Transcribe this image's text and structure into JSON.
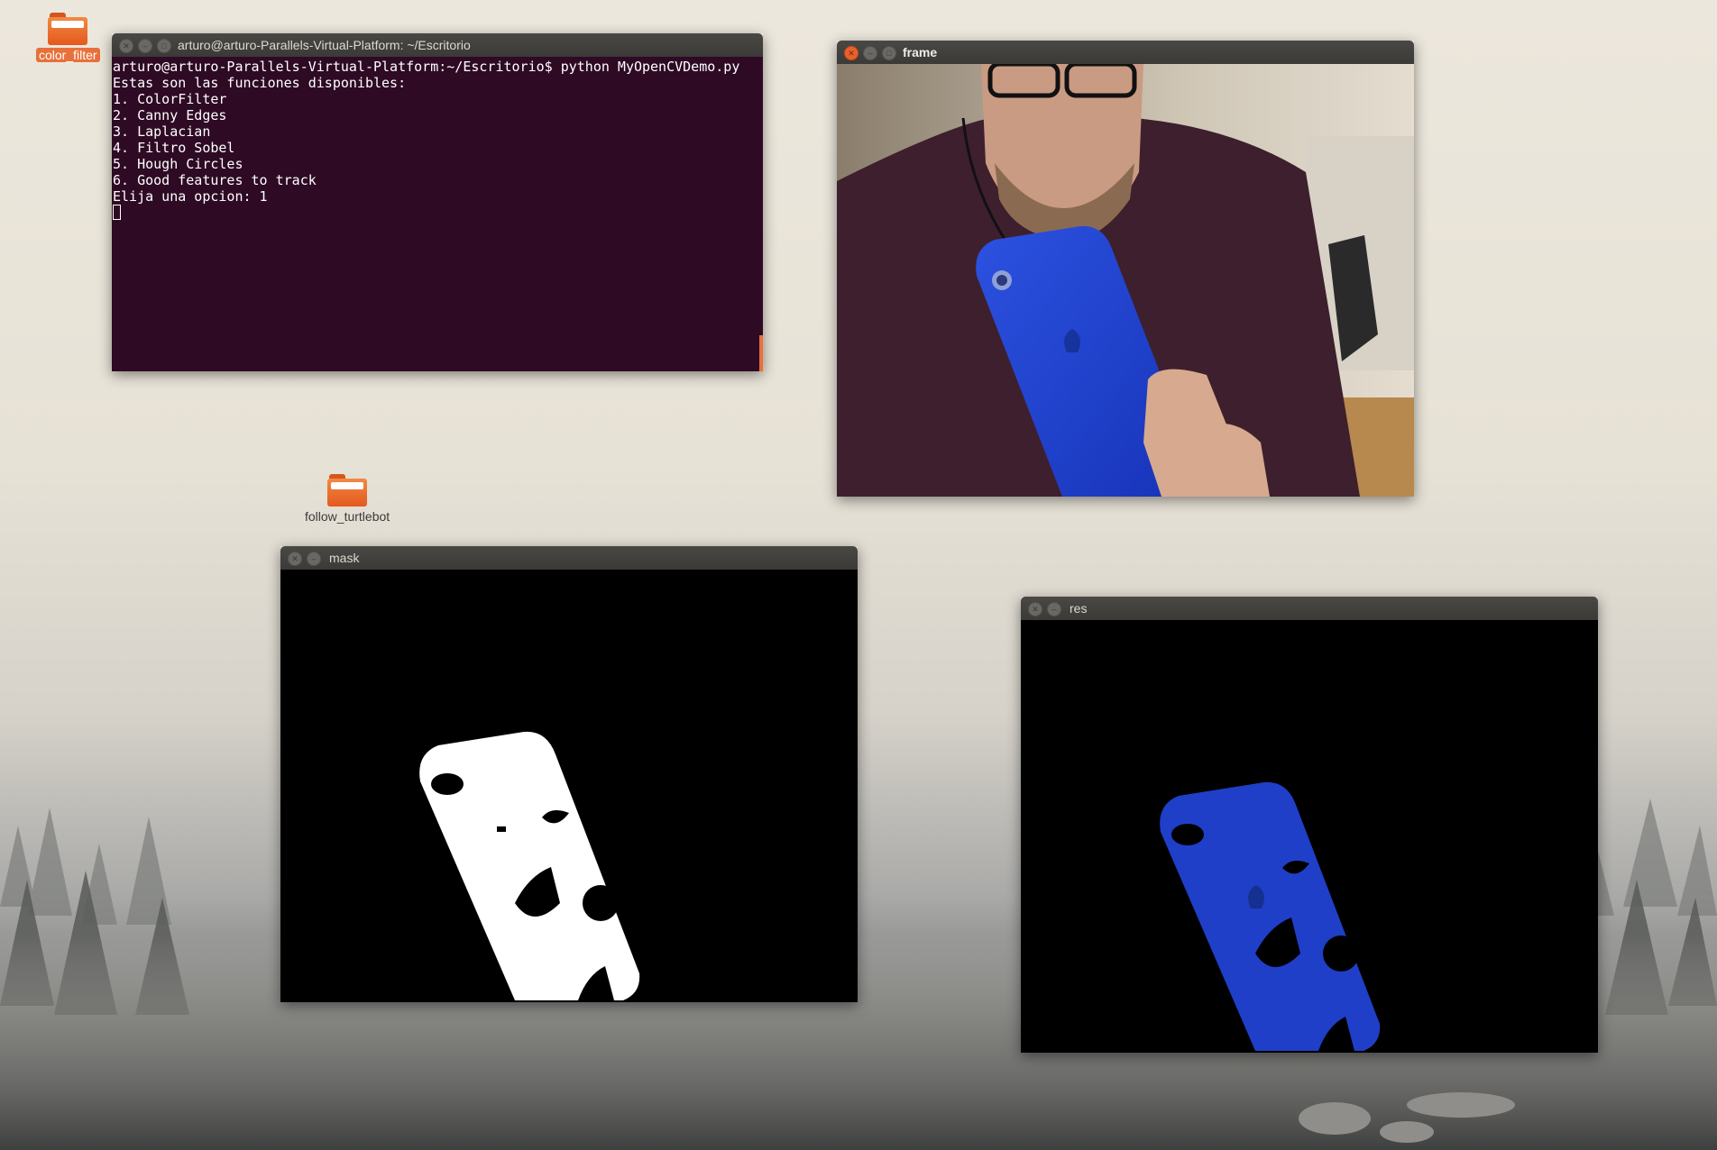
{
  "desktop": {
    "icons": [
      {
        "label": "color_filter",
        "selected": true
      },
      {
        "label": "follow_turtlebot",
        "selected": false
      }
    ]
  },
  "terminal": {
    "title": "arturo@arturo-Parallels-Virtual-Platform: ~/Escritorio",
    "lines": [
      "arturo@arturo-Parallels-Virtual-Platform:~/Escritorio$ python MyOpenCVDemo.py",
      "Estas son las funciones disponibles:",
      "1. ColorFilter",
      "2. Canny Edges",
      "3. Laplacian",
      "4. Filtro Sobel",
      "5. Hough Circles",
      "6. Good features to track",
      "Elija una opcion: 1"
    ]
  },
  "windows": {
    "frame": {
      "title": "frame"
    },
    "mask": {
      "title": "mask"
    },
    "res": {
      "title": "res"
    }
  },
  "colors": {
    "terminal_bg": "#2e0a24",
    "accent": "#e8703a",
    "phone_blue": "#1f3fc8"
  }
}
